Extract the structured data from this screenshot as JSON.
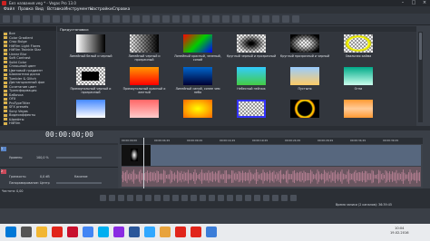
{
  "window": {
    "title": "Без названия.veg * - Vegas Pro 13.0"
  },
  "menu": [
    "Файл",
    "Правка",
    "Вид",
    "Вставка",
    "Инструменты",
    "Настройки",
    "Справка"
  ],
  "tree": {
    "header": "Все",
    "items": [
      "Все",
      "Color Gradient",
      "Crop Bulge",
      "HitFilm Light Flares",
      "HitFilm Twinkle Star",
      "Linear Blur",
      "Soft Contrast",
      "Solid Color",
      "Сплошной цвет",
      "Цветовой градиент",
      "Шахматная доска",
      "Tumbler & Glitch",
      "Дистанционный фон",
      "Сочетание цвет",
      "Трансформация",
      "Бабочка",
      "OFX",
      "ProTypeTitler",
      "SFX presets",
      "Sony Vegas",
      "Видеоэффекты",
      "Шрифты",
      "HitFilm"
    ]
  },
  "presets": {
    "header": "Предустановки:",
    "items": [
      {
        "label": "Линейный белый и черный",
        "style": "linear-gradient(90deg,#fff,#000)"
      },
      {
        "label": "Линейный черный и прозрачный",
        "style": "checker-dark"
      },
      {
        "label": "Линейный красный, зеленый, синий",
        "style": "linear-gradient(135deg,#f00,#0c0,#00f)"
      },
      {
        "label": "Круглый черный и прозрачный",
        "style": "checker-radial"
      },
      {
        "label": "Круглый прозрачный и черный",
        "style": "checker-radial-dark"
      },
      {
        "label": "Овальная кайма",
        "style": "oval"
      },
      {
        "label": "Прямоугольный черный и прозрачный",
        "style": "checker-rect"
      },
      {
        "label": "Прямоугольный красный и желтый",
        "style": "linear-gradient(180deg,#f90,#f00)"
      },
      {
        "label": "Линейный синий, синее чем небо",
        "style": "linear-gradient(180deg,#06c,#003)"
      },
      {
        "label": "Небесный пейзаж",
        "style": "linear-gradient(180deg,#3cf,#4c4)"
      },
      {
        "label": "Пустыня",
        "style": "linear-gradient(180deg,#9cf,#fc6)"
      },
      {
        "label": "Огни",
        "style": "linear-gradient(180deg,#0a8,#cfe)"
      },
      {
        "label": "",
        "style": "linear-gradient(180deg,#48f,#fff)"
      },
      {
        "label": "",
        "style": "linear-gradient(180deg,#f66,#fcc)"
      },
      {
        "label": "",
        "style": "radial-gradient(#ff0,#f60)"
      },
      {
        "label": "",
        "style": "checker-blue"
      },
      {
        "label": "",
        "style": "ring"
      },
      {
        "label": "",
        "style": "linear-gradient(180deg,#f93,#fc9,#f93)"
      }
    ]
  },
  "timeline": {
    "timecode": "00:00:00;00",
    "ruler": [
      "00:00:00;00",
      "00:00:04;29",
      "00:00:09;29",
      "00:00:14;29",
      "00:00:19;29",
      "00:00:24;29",
      "00:00:29;29",
      "00:00:34;29",
      "00:00:39;29"
    ],
    "video_track": {
      "number": "1",
      "level_label": "Уровень:",
      "level_value": "100,0 %"
    },
    "audio_track": {
      "number": "2",
      "volume_label": "Громкость:",
      "volume_value": "0,0 dB",
      "pan_label": "Панорамирование:",
      "pan_value": "Центр",
      "mute_label": "Касание"
    },
    "rate_label": "Частота: 0,00",
    "status": "Время записи (2 каналов): 36:39:45"
  },
  "taskbar": {
    "icons": [
      "windows",
      "search",
      "explorer",
      "yandex",
      "opera",
      "chrome",
      "skype",
      "vegas",
      "word",
      "photoshop",
      "folder",
      "yandex2",
      "yandex3",
      "screen"
    ],
    "time": "10:04",
    "date": "19.02.2016"
  },
  "colors": {
    "accent": "#5a86c9",
    "folder": "#d9b24c"
  }
}
